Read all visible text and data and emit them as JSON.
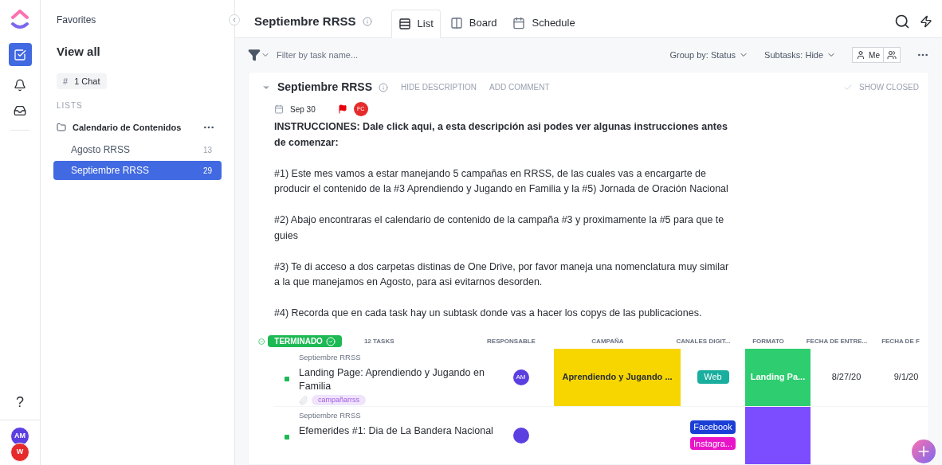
{
  "rail": {
    "avatars": [
      {
        "initials": "AM",
        "color": "#5b3fe0"
      },
      {
        "initials": "W",
        "color": "#e52b2b"
      }
    ],
    "help": "?"
  },
  "sidebar": {
    "favorites": "Favorites",
    "view_all": "View all",
    "chat": {
      "icon": "#",
      "label": "1 Chat"
    },
    "lists_label": "LISTS",
    "folder": {
      "name": "Calendario de Contenidos",
      "items": [
        {
          "name": "Agosto RRSS",
          "count": "13",
          "selected": false
        },
        {
          "name": "Septiembre RRSS",
          "count": "29",
          "selected": true
        }
      ]
    }
  },
  "header": {
    "title": "Septiembre RRSS",
    "tabs": [
      {
        "label": "List",
        "kind": "list",
        "selected": true
      },
      {
        "label": "Board",
        "kind": "board",
        "selected": false
      },
      {
        "label": "Schedule",
        "kind": "schedule",
        "selected": false
      }
    ]
  },
  "toolbar": {
    "filter_placeholder": "Filter by task name...",
    "group_by": {
      "label": "Group by:",
      "value": "Status"
    },
    "subtasks": {
      "label": "Subtasks:",
      "value": "Hide"
    },
    "me": "Me"
  },
  "description": {
    "title": "Septiembre RRSS",
    "actions": [
      "HIDE DESCRIPTION",
      "ADD COMMENT"
    ],
    "show_closed": "SHOW CLOSED",
    "date": "Sep 30",
    "assignee": "FC",
    "paragraphs": [
      "**INSTRUCCIONES: Dale click aqui, a esta descripción asi podes ver algunas instrucciones antes de comenzar:**",
      "#1) Este mes vamos a estar manejando 5 campañas en RRSS, de las cuales vas a encargarte de producir el contenido de la #3 Aprendiendo y Jugando en Familia y la #5) Jornada de Oración Nacional",
      "#2) Abajo encontraras el calendario de contenido de la campaña #3 y proximamente la #5 para que te guies",
      "#3) Te di acceso a dos carpetas distinas de One Drive, por favor maneja una nomenclatura muy similar a la que manejamos en Agosto, para asi evitarnos desorden.",
      "#4) Recorda que en cada task hay un subtask donde vas a hacer los copys de las publicaciones."
    ]
  },
  "group": {
    "status": "TERMINADO",
    "color": "#1db954",
    "count": "12 TASKS",
    "columns": [
      "RESPONSABLE",
      "CAMPAÑA",
      "CANALES DIGIT...",
      "FORMATO",
      "FECHA DE ENTRE...",
      "FECHA DE F"
    ],
    "rows": [
      {
        "list": "Septiembre RRSS",
        "name": "Landing Page: Aprendiendo y Jugando en Familia",
        "tag": "campañarrss",
        "assignee": {
          "initials": "AM",
          "color": "#5b3fe0"
        },
        "campaign": {
          "text": "Aprendiendo y Jugando ...",
          "color": "#f7d600"
        },
        "channels": [
          {
            "label": "Web",
            "color": "#1aae9f"
          }
        ],
        "format": {
          "text": "Landing Pa...",
          "color": "#2ecd6f"
        },
        "date_1": "8/27/20",
        "date_2": "9/1/20"
      },
      {
        "list": "Septiembre RRSS",
        "name": "Efemerides #1: Dia de La Bandera Nacional",
        "assignee": {
          "color": "#5b3fe0"
        },
        "channels": [
          {
            "label": "Facebook",
            "color": "#1b3fd6"
          },
          {
            "label": "Instagra...",
            "color": "#e814c8"
          }
        ],
        "format": {
          "color": "#7c4dff"
        }
      }
    ]
  }
}
